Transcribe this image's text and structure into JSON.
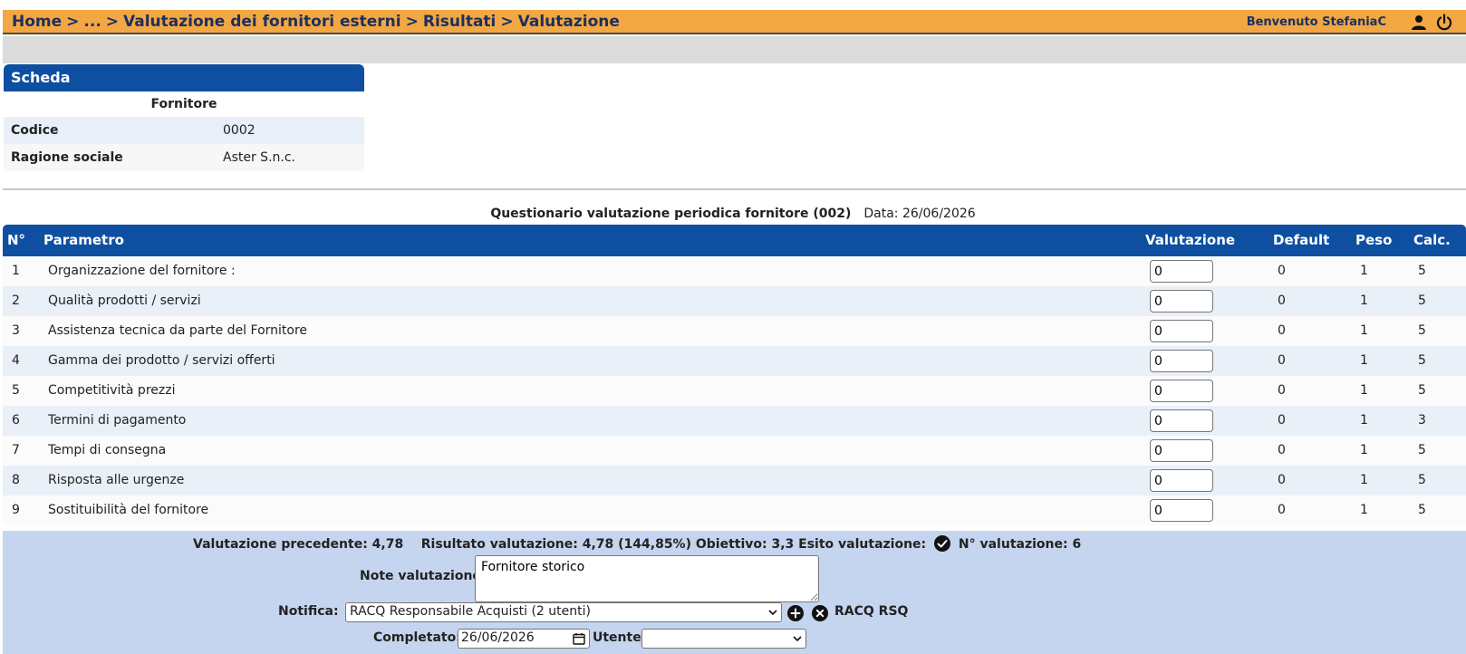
{
  "header": {
    "breadcrumb": [
      "Home",
      "...",
      "Valutazione dei fornitori esterni",
      "Risultati",
      "Valutazione"
    ],
    "breadcrumb_separator": ">",
    "welcome": "Benvenuto StefaniaC",
    "icons": [
      "user-icon",
      "power-icon"
    ],
    "accent_color": "#f2a743"
  },
  "scheda": {
    "title": "Scheda",
    "subtitle": "Fornitore",
    "rows": [
      {
        "label": "Codice",
        "value": "0002"
      },
      {
        "label": "Ragione sociale",
        "value": "Aster S.n.c."
      }
    ]
  },
  "questionnaire": {
    "title": "Questionario valutazione periodica fornitore (002)",
    "date": "Data: 26/06/2026"
  },
  "table": {
    "headers": {
      "n": "N°",
      "parametro": "Parametro",
      "valutazione": "Valutazione",
      "default": "Default",
      "peso": "Peso",
      "calc": "Calc."
    },
    "header_color": "#0e4fa1",
    "rows": [
      {
        "n": "1",
        "parametro": "Organizzazione del fornitore :",
        "valutazione": "0",
        "default": "0",
        "peso": "1",
        "calc": "5"
      },
      {
        "n": "2",
        "parametro": "Qualità prodotti / servizi",
        "valutazione": "0",
        "default": "0",
        "peso": "1",
        "calc": "5"
      },
      {
        "n": "3",
        "parametro": "Assistenza tecnica da parte del Fornitore",
        "valutazione": "0",
        "default": "0",
        "peso": "1",
        "calc": "5"
      },
      {
        "n": "4",
        "parametro": "Gamma dei prodotto / servizi offerti",
        "valutazione": "0",
        "default": "0",
        "peso": "1",
        "calc": "5"
      },
      {
        "n": "5",
        "parametro": "Competitività prezzi",
        "valutazione": "0",
        "default": "0",
        "peso": "1",
        "calc": "5"
      },
      {
        "n": "6",
        "parametro": "Termini di pagamento",
        "valutazione": "0",
        "default": "0",
        "peso": "1",
        "calc": "3"
      },
      {
        "n": "7",
        "parametro": "Tempi di consegna",
        "valutazione": "0",
        "default": "0",
        "peso": "1",
        "calc": "5"
      },
      {
        "n": "8",
        "parametro": "Risposta alle urgenze",
        "valutazione": "0",
        "default": "0",
        "peso": "1",
        "calc": "5"
      },
      {
        "n": "9",
        "parametro": "Sostituibilità del fornitore",
        "valutazione": "0",
        "default": "0",
        "peso": "1",
        "calc": "5"
      }
    ]
  },
  "footer": {
    "precedente": "Valutazione precedente: 4,78",
    "risultato": "Risultato valutazione: 4,78 (144,85%)",
    "obiettivo": "Obiettivo: 3,3",
    "esito": "Esito valutazione:",
    "n_valutazione": "N° valutazione: 6",
    "note_label": "Note valutazione:",
    "note_value": "Fornitore storico",
    "notifica_label": "Notifica:",
    "notifica_value": "RACQ Responsabile Acquisti (2 utenti)",
    "notifica_recipients": "RACQ RSQ",
    "completato_label": "Completato:",
    "completato_value": "26/06/2026",
    "utente_label": "Utente:",
    "utente_value": "",
    "panel_color": "#c5d4ef"
  }
}
